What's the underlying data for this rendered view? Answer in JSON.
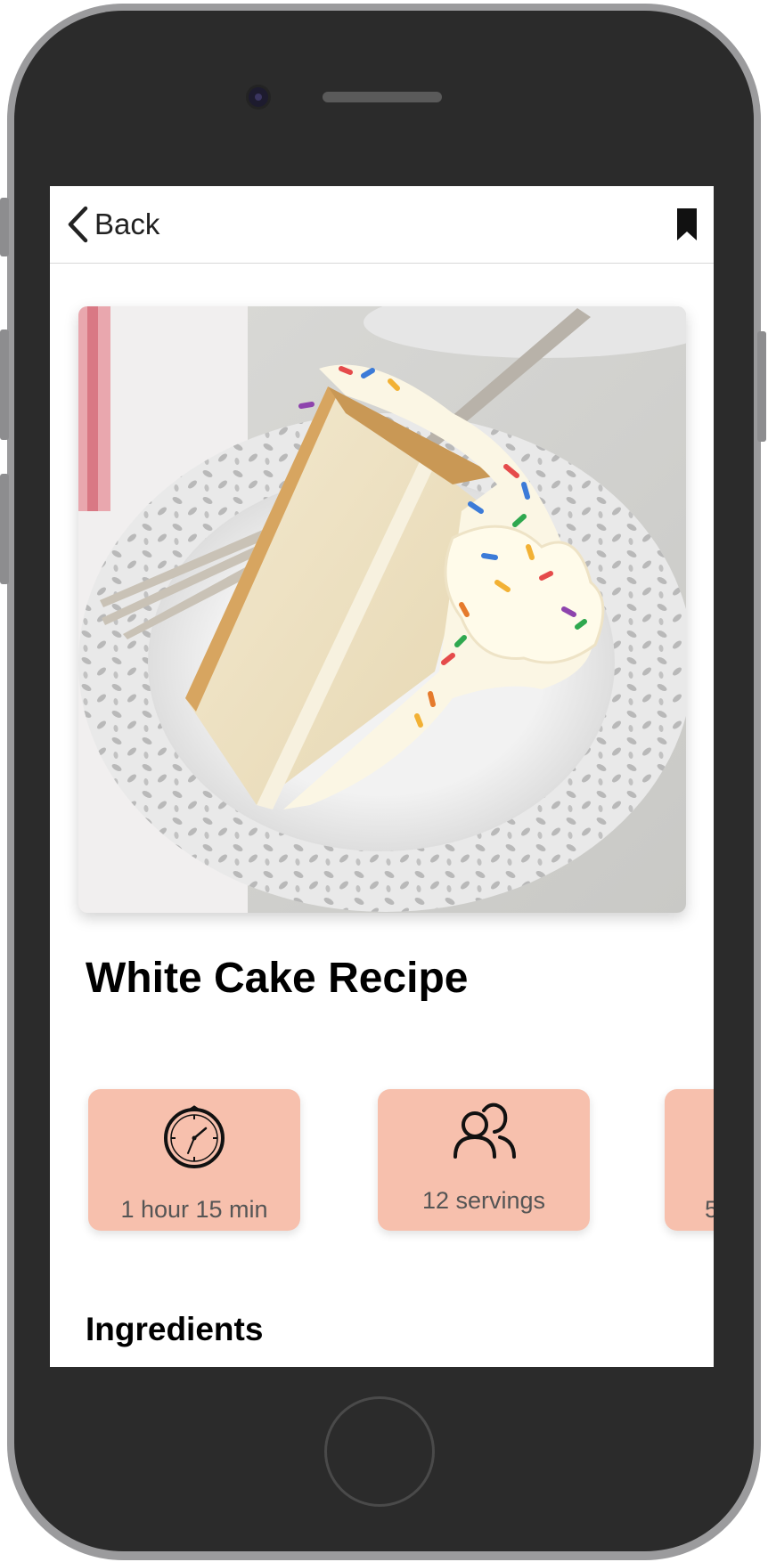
{
  "header": {
    "back_label": "Back",
    "back_icon": "chevron-left-icon",
    "bookmark_icon": "bookmark-icon"
  },
  "recipe": {
    "title": "White Cake Recipe",
    "image_subject": "slice of white layer cake with sprinkles on a white lace plate"
  },
  "info_cards": [
    {
      "icon": "clock-icon",
      "label": "1 hour 15 min"
    },
    {
      "icon": "people-icon",
      "label": "12 servings"
    },
    {
      "icon": "",
      "label": "5"
    }
  ],
  "sections": {
    "ingredients_heading": "Ingredients"
  },
  "colors": {
    "card_background": "#f7c0ad",
    "phone_body": "#2b2b2b",
    "phone_bezel": "#9b9b9d"
  }
}
